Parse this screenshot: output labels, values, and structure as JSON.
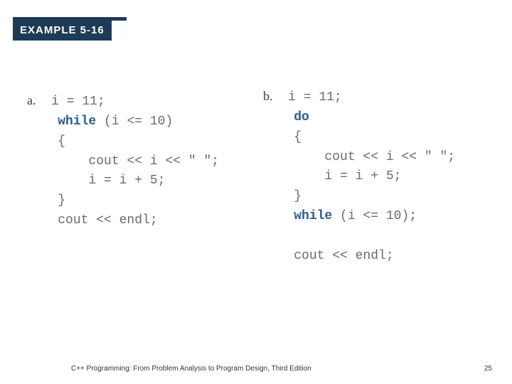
{
  "header": {
    "badge": "EXAMPLE 5-16"
  },
  "colA": {
    "label": "a.",
    "l1a": "i = 11;",
    "l2kw": "while",
    "l2b": " (i <= 10)",
    "l3": "{",
    "l4": "    cout << i << \" \";",
    "l5": "    i = i + 5;",
    "l6": "}",
    "l7": "cout << endl;"
  },
  "colB": {
    "label": "b.",
    "l1a": "i = 11;",
    "l2kw": "do",
    "l3": "{",
    "l4": "    cout << i << \" \";",
    "l5": "    i = i + 5;",
    "l6": "}",
    "l7kw": "while",
    "l7b": " (i <= 10);",
    "l8blank": "",
    "l9": "cout << endl;"
  },
  "footer": {
    "title": "C++ Programming: From Problem Analysis to Program Design, Third Edition",
    "page": "25"
  }
}
